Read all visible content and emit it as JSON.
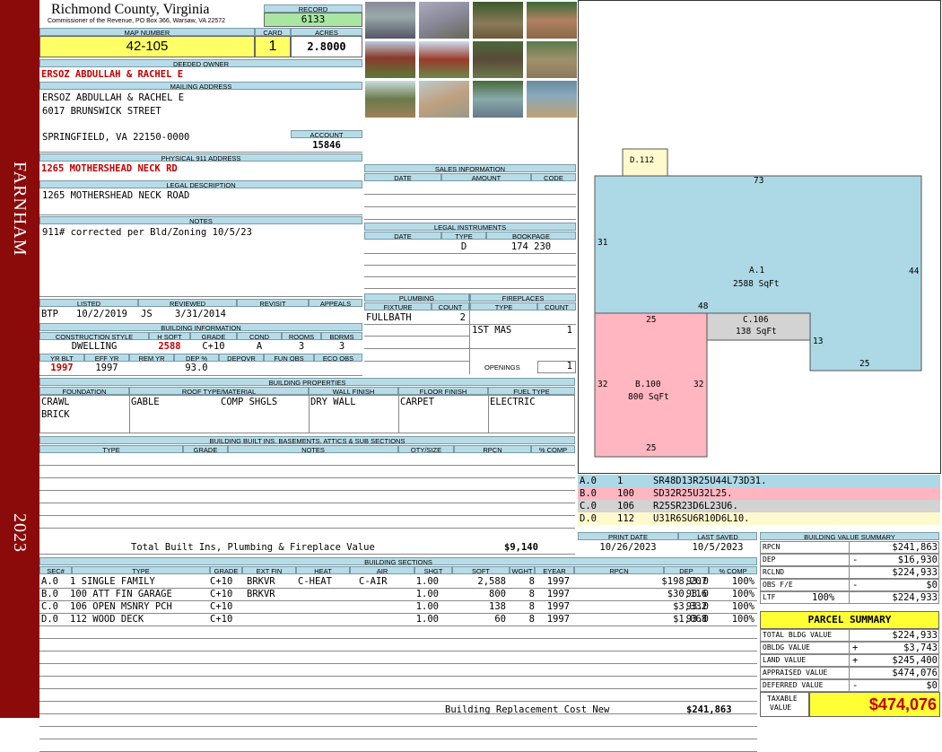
{
  "sidebar": {
    "district": "FARNHAM",
    "year": "2023"
  },
  "header": {
    "county": "Richmond County, Virginia",
    "commissioner": "Commissioner of the Revenue, PO Box 366, Warsaw, VA 22572",
    "record_label": "RECORD",
    "record": "6133",
    "map_label": "MAP NUMBER",
    "map": "42-105",
    "card_label": "CARD",
    "card": "1",
    "acres_label": "ACRES",
    "acres": "2.8000"
  },
  "owner": {
    "label": "DEEDED OWNER",
    "name": "ERSOZ ABDULLAH & RACHEL E",
    "mail_label": "MAILING ADDRESS",
    "mail1": "ERSOZ ABDULLAH & RACHEL E",
    "mail2": "6017 BRUNSWICK STREET",
    "mail3": "SPRINGFIELD, VA 22150-0000",
    "account_label": "ACCOUNT",
    "account": "15846"
  },
  "physical": {
    "label": "PHYSICAL 911 ADDRESS",
    "value": "1265 MOTHERSHEAD NECK RD"
  },
  "legal": {
    "label": "LEGAL DESCRIPTION",
    "value": "1265 MOTHERSHEAD NECK ROAD"
  },
  "notes": {
    "label": "NOTES",
    "value": "911# corrected per Bld/Zoning 10/5/23"
  },
  "listing": {
    "listed_label": "LISTED",
    "reviewed_label": "REVIEWED",
    "revisit_label": "REVISIT",
    "appeals_label": "APPEALS",
    "listed_by": "BTP",
    "listed_date": "10/2/2019",
    "reviewed_by": "JS",
    "reviewed_date": "3/31/2014"
  },
  "bldg_info": {
    "label": "BUILDING INFORMATION",
    "cols": [
      "CONSTRUCTION STYLE",
      "H SQFT",
      "GRADE",
      "COND",
      "ROOMS",
      "BDRMS"
    ],
    "style": "DWELLING",
    "hsqft": "2588",
    "grade": "C+10",
    "cond": "A",
    "rooms": "3",
    "bdrms": "3",
    "cols2": [
      "YR BLT",
      "EFF YR",
      "REM YR",
      "DEP %",
      "DEPOVR",
      "FUN OBS",
      "ECO OBS"
    ],
    "yrblt": "1997",
    "effyr": "1997",
    "dep": "93.0"
  },
  "props": {
    "label": "BUILDING PROPERTIES",
    "cols": [
      "FOUNDATION",
      "ROOF TYPE/MATERIAL",
      "WALL FINISH",
      "FLOOR FINISH",
      "FUEL TYPE"
    ],
    "foundation1": "CRAWL",
    "foundation2": "BRICK",
    "roof_type": "GABLE",
    "roof_mat": "COMP SHGLS",
    "wall": "DRY WALL",
    "floor": "CARPET",
    "fuel": "ELECTRIC"
  },
  "builtins": {
    "label": "BUILDING BUILT INS, BASEMENTS, ATTICS & SUB SECTIONS",
    "cols": [
      "TYPE",
      "GRADE",
      "NOTES",
      "QTY/SIZE",
      "RPCN",
      "% COMP"
    ],
    "total_label": "Total Built Ins, Plumbing & Fireplace Value",
    "total": "$9,140"
  },
  "sales": {
    "label": "SALES INFORMATION",
    "cols": [
      "DATE",
      "AMOUNT",
      "CODE"
    ]
  },
  "instruments": {
    "label": "LEGAL INSTRUMENTS",
    "cols": [
      "DATE",
      "TYPE",
      "BOOKPAGE"
    ],
    "type": "D",
    "bookpage": "174 230"
  },
  "plumbing": {
    "label": "PLUMBING",
    "cols": [
      "FIXTURE",
      "COUNT"
    ],
    "fixture": "FULLBATH",
    "count": "2"
  },
  "fireplaces": {
    "label": "FIREPLACES",
    "cols": [
      "TYPE",
      "COUNT"
    ],
    "type": "1ST MAS",
    "count": "1",
    "openings_label": "OPENINGS",
    "openings": "1"
  },
  "sketch": {
    "d_label": "D.112",
    "a_label": "A.1",
    "a_area": "2588 SqFt",
    "b_label": "B.100",
    "b_area": "800 SqFt",
    "c_label": "C.106",
    "c_area": "138 SqFt",
    "dims": [
      "73",
      "31",
      "44",
      "48",
      "25",
      "13",
      "25",
      "32",
      "32",
      "25"
    ]
  },
  "sketch_legend": [
    {
      "code": "A.0",
      "num": "1",
      "vec": "SR48D13R25U44L73D31.",
      "color": "#add8e6"
    },
    {
      "code": "B.0",
      "num": "100",
      "vec": "SD32R25U32L25.",
      "color": "#ffb6c1"
    },
    {
      "code": "C.0",
      "num": "106",
      "vec": "R25SR23D6L23U6.",
      "color": "#d3d3d3"
    },
    {
      "code": "D.0",
      "num": "112",
      "vec": "U31R6SU6R10D6L10.",
      "color": "#fffacd"
    }
  ],
  "dates": {
    "print_label": "PRINT DATE",
    "print": "10/26/2023",
    "saved_label": "LAST SAVED",
    "saved": "10/5/2023"
  },
  "sections": {
    "label": "BUILDING SECTIONS",
    "cols": [
      "SEC#",
      "TYPE",
      "GRADE",
      "EXT FIN",
      "HEAT",
      "AIR",
      "SHGT",
      "SQFT",
      "WGHT",
      "EYEAR",
      "RPCN",
      "DEP",
      "% COMP"
    ],
    "rows": [
      [
        "A.0",
        "1 SINGLE FAMILY",
        "C+10",
        "BRKVR",
        "C-HEAT",
        "C-AIR",
        "1.00",
        "2,588",
        "8",
        "1997",
        "$198,207",
        "93.0",
        "100%"
      ],
      [
        "B.0",
        "100 ATT FIN GARAGE",
        "C+10",
        "BRKVR",
        "",
        "",
        "1.00",
        "800",
        "8",
        "1997",
        "$30,116",
        "93.0",
        "100%"
      ],
      [
        "C.0",
        "106 OPEN MSNRY PCH",
        "C+10",
        "",
        "",
        "",
        "1.00",
        "138",
        "8",
        "1997",
        "$3,332",
        "93.0",
        "100%"
      ],
      [
        "D.0",
        "112 WOOD DECK",
        "C+10",
        "",
        "",
        "",
        "1.00",
        "60",
        "8",
        "1997",
        "$1,068",
        "93.0",
        "100%"
      ]
    ],
    "replacement_label": "Building Replacement Cost New",
    "replacement": "$241,863"
  },
  "bvs": {
    "label": "BUILDING VALUE SUMMARY",
    "rows": [
      [
        "RPCN",
        "",
        "$241,863"
      ],
      [
        "DEP",
        "-",
        "$16,930"
      ],
      [
        "RCLND",
        "",
        "$224,933"
      ],
      [
        "OBS F/E",
        "-",
        "$0"
      ],
      [
        "LTF",
        "100%",
        "$224,933"
      ]
    ]
  },
  "parcel": {
    "label": "PARCEL SUMMARY",
    "rows": [
      [
        "TOTAL BLDG VALUE",
        "",
        "$224,933"
      ],
      [
        "OBLDG VALUE",
        "+",
        "$3,743"
      ],
      [
        "LAND VALUE",
        "+",
        "$245,400"
      ],
      [
        "APPRAISED VALUE",
        "",
        "$474,076"
      ],
      [
        "DEFERRED VALUE",
        "-",
        "$0"
      ]
    ],
    "taxable_label1": "TAXABLE",
    "taxable_label2": "VALUE",
    "taxable": "$474,076"
  }
}
